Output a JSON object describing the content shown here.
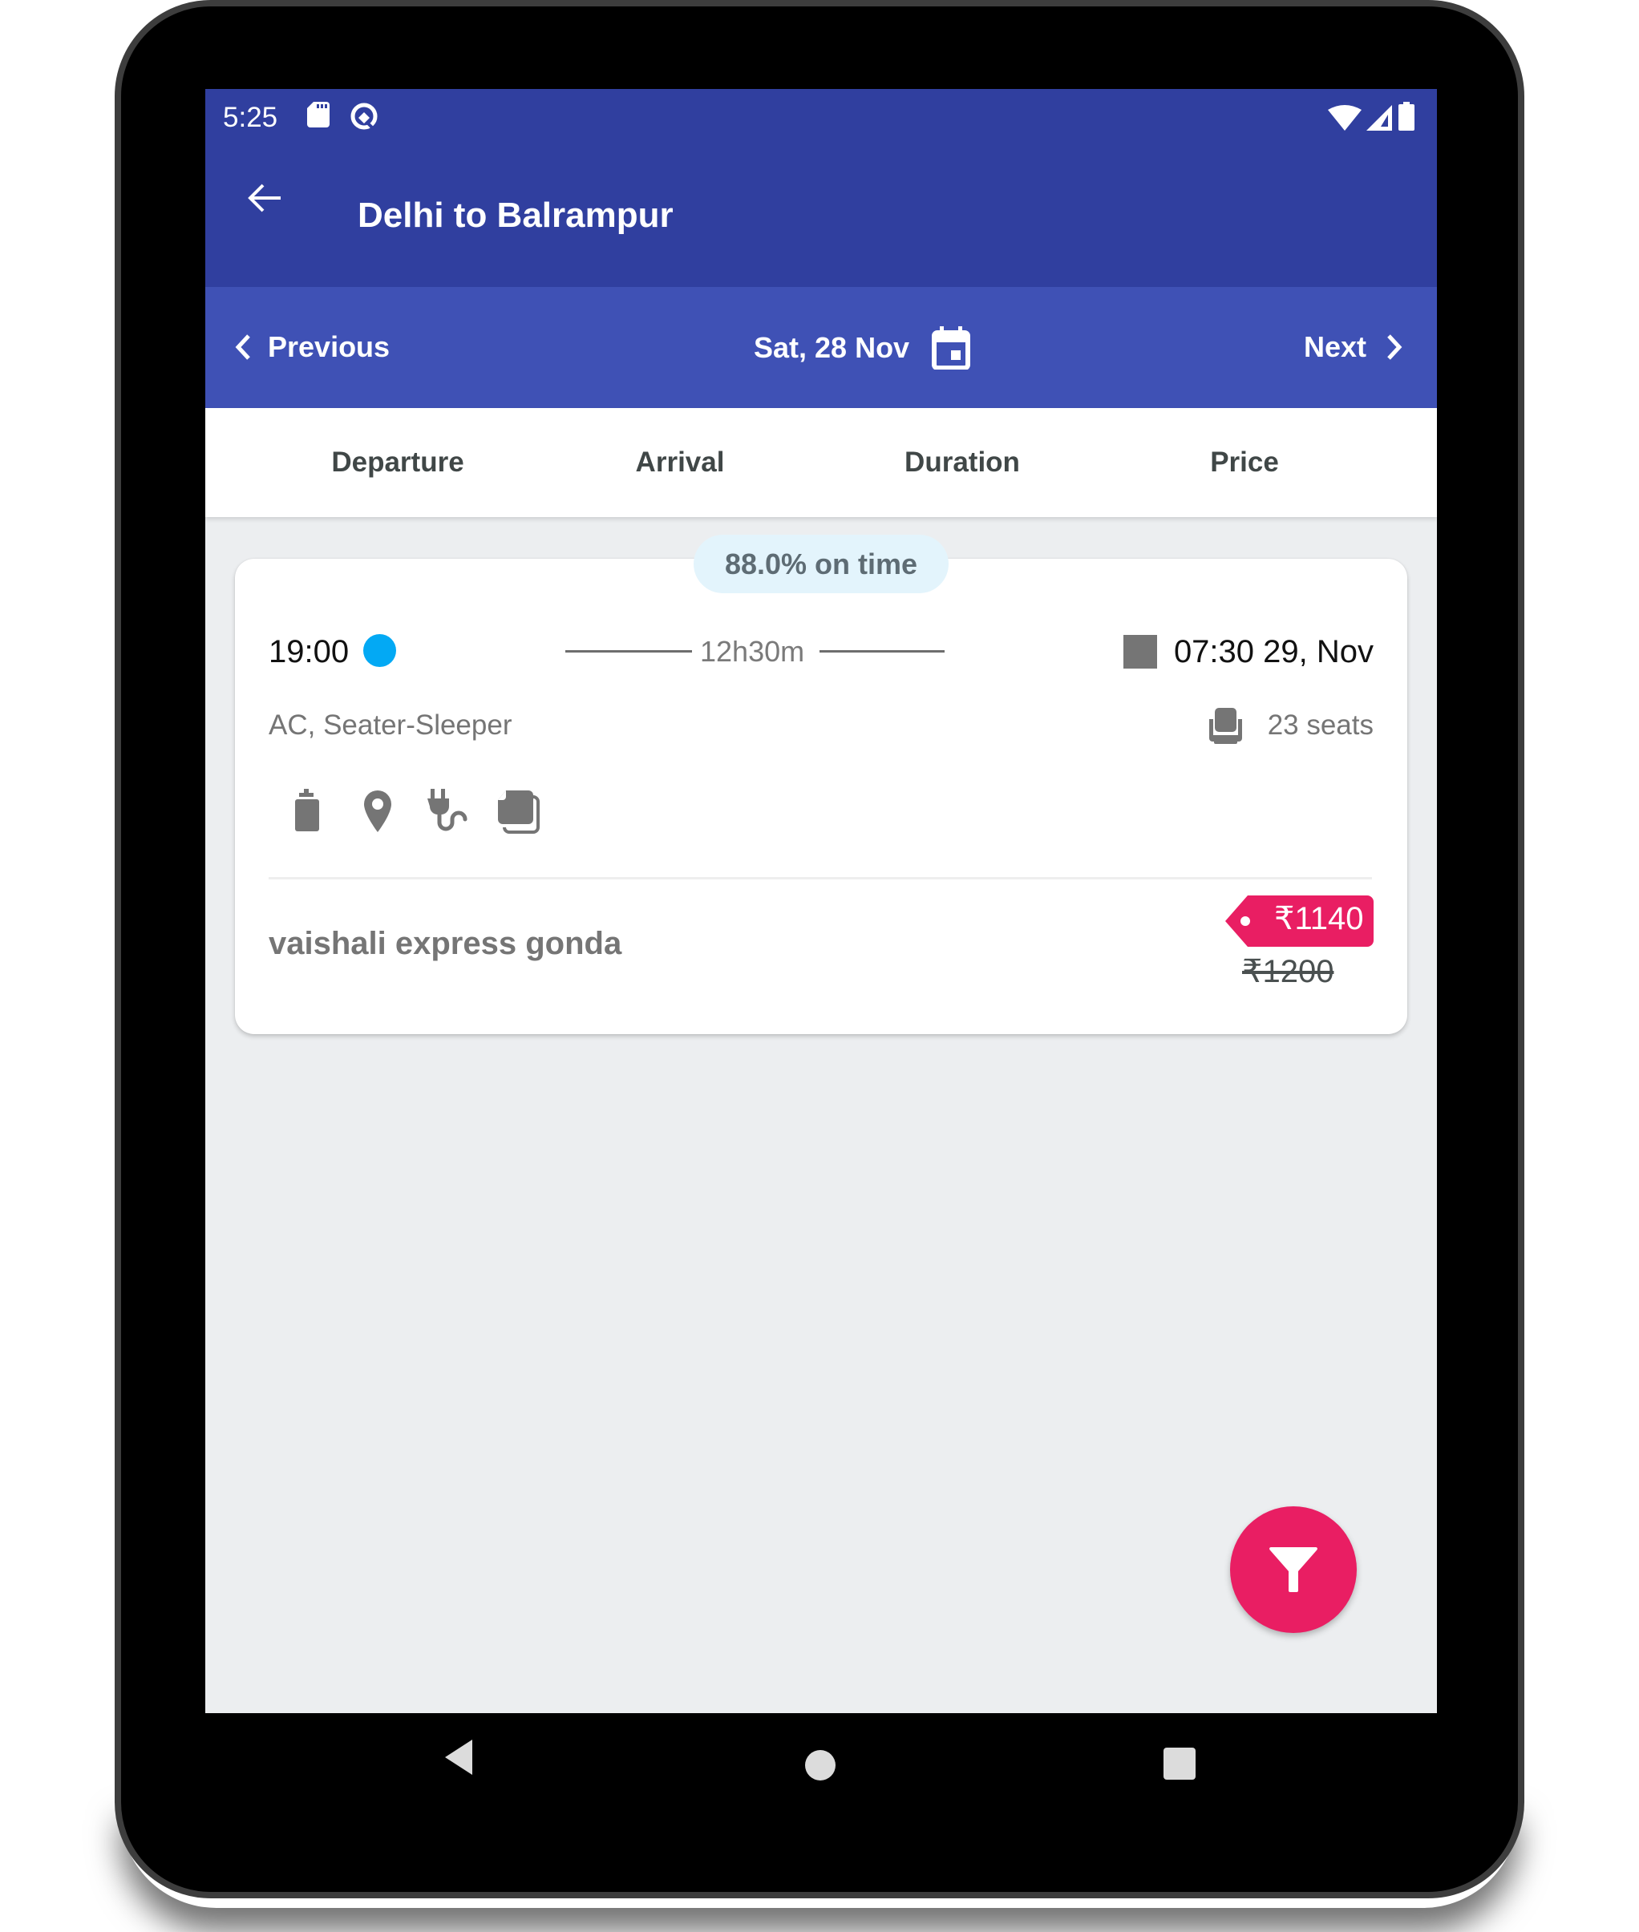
{
  "status_bar": {
    "time": "5:25",
    "left_icons": [
      "sd-card-icon",
      "q-notification-icon"
    ],
    "right_icons": [
      "wifi-icon",
      "signal-icon",
      "battery-icon"
    ]
  },
  "toolbar": {
    "title": "Delhi to Balrampur",
    "back_icon": "arrow-left-icon"
  },
  "date_bar": {
    "previous_label": "Previous",
    "date_label": "Sat, 28 Nov",
    "next_label": "Next",
    "calendar_icon": "calendar-icon"
  },
  "sort_tabs": [
    {
      "label": "Departure"
    },
    {
      "label": "Arrival"
    },
    {
      "label": "Duration"
    },
    {
      "label": "Price"
    }
  ],
  "results": [
    {
      "on_time_badge": "88.0% on time",
      "departure_time": "19:00",
      "duration": "12h30m",
      "arrival_time": "07:30 29, Nov",
      "bus_type": "AC, Seater-Sleeper",
      "seats": "23 seats",
      "amenities": [
        "water-bottle-icon",
        "location-pin-icon",
        "charging-plug-icon",
        "blanket-icon"
      ],
      "operator_name": "vaishali express gonda",
      "price": "₹1140",
      "original_price": "₹1200"
    }
  ],
  "fab": {
    "icon": "filter-icon"
  },
  "system_nav": [
    "back",
    "home",
    "recents"
  ],
  "colors": {
    "primary_dark": "#303F9F",
    "primary": "#3F51B5",
    "accent": "#E91E63",
    "departure_dot": "#03A9F4",
    "badge_bg": "#E3F4FC",
    "background": "#ECEEF0"
  }
}
